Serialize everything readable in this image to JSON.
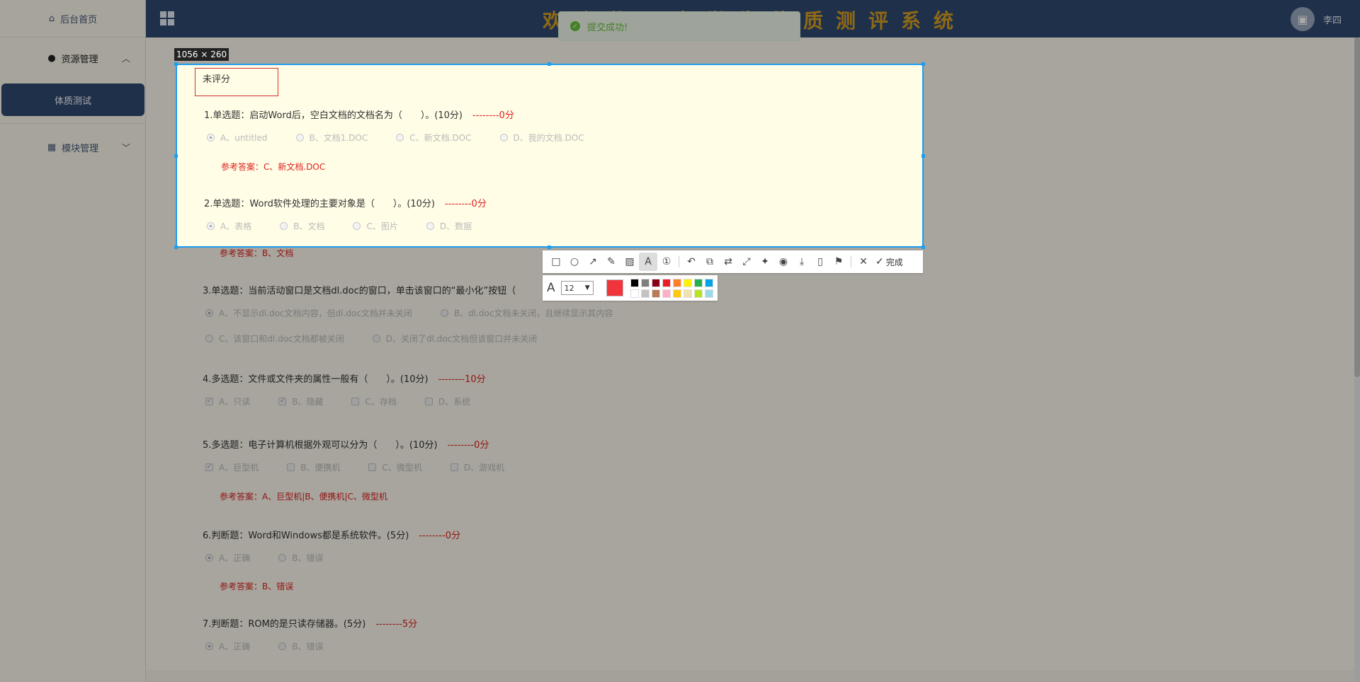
{
  "sidebar": {
    "home": "后台首页",
    "resource": "资源管理",
    "sub_item": "体质测试",
    "module": "模块管理"
  },
  "header": {
    "title": "欢迎使用大学生体质测评系统",
    "user": "李四"
  },
  "toast": "提交成功!",
  "screenshot": {
    "size_label": "1056 × 260",
    "stamp": "未评分",
    "font_size": "12",
    "done_label": "完成",
    "current_color": "#f0343c",
    "palette": [
      "#000000",
      "#7f7f7f",
      "#880015",
      "#ed1c24",
      "#ff7f27",
      "#fff200",
      "#22b14c",
      "#00a2e8",
      "#ffffff",
      "#c3c3c3",
      "#b97a57",
      "#ffaec9",
      "#ffc90e",
      "#efe4b0",
      "#b5e61d",
      "#99d9ea"
    ]
  },
  "questions": [
    {
      "title": "1.单选题：启动Word后，空白文档的文档名为（　　）。(10分)",
      "score": "--------0分",
      "options": [
        "A、untitled",
        "B、文档1.DOC",
        "C、新文档.DOC",
        "D、我的文档.DOC"
      ],
      "answer": "参考答案：C、新文档.DOC"
    },
    {
      "title": "2.单选题：Word软件处理的主要对象是（　　）。(10分)",
      "score": "--------0分",
      "options": [
        "A、表格",
        "B、文档",
        "C、图片",
        "D、数据"
      ],
      "answer": "参考答案：B、文档"
    },
    {
      "title": "3.单选题：当前活动窗口是文档dl.doc的窗口，单击该窗口的“最小化”按钮（",
      "score": "",
      "options": [
        "A、不显示dl.doc文档内容，但dl.doc文档并未关闭",
        "B、dl.doc文档未关闭，且继续显示其内容",
        "C、该窗口和dl.doc文档都被关闭",
        "D、关闭了dl.doc文档但该窗口并未关闭"
      ],
      "answer": ""
    },
    {
      "title": "4.多选题：文件或文件夹的属性一般有（　　）。(10分)",
      "score": "--------10分",
      "options": [
        "A、只读",
        "B、隐藏",
        "C、存档",
        "D、系统"
      ],
      "answer": ""
    },
    {
      "title": "5.多选题：电子计算机根据外观可以分为（　　）。(10分)",
      "score": "--------0分",
      "options": [
        "A、巨型机",
        "B、便携机",
        "C、微型机",
        "D、游戏机"
      ],
      "answer": "参考答案：A、巨型机|B、便携机|C、微型机"
    },
    {
      "title": "6.判断题：Word和Windows都是系统软件。(5分)",
      "score": "--------0分",
      "options": [
        "A、正确",
        "B、错误"
      ],
      "answer": "参考答案：B、错误"
    },
    {
      "title": "7.判断题：ROM的是只读存储器。(5分)",
      "score": "--------5分",
      "options": [
        "A、正确",
        "B、错误"
      ],
      "answer": ""
    }
  ]
}
